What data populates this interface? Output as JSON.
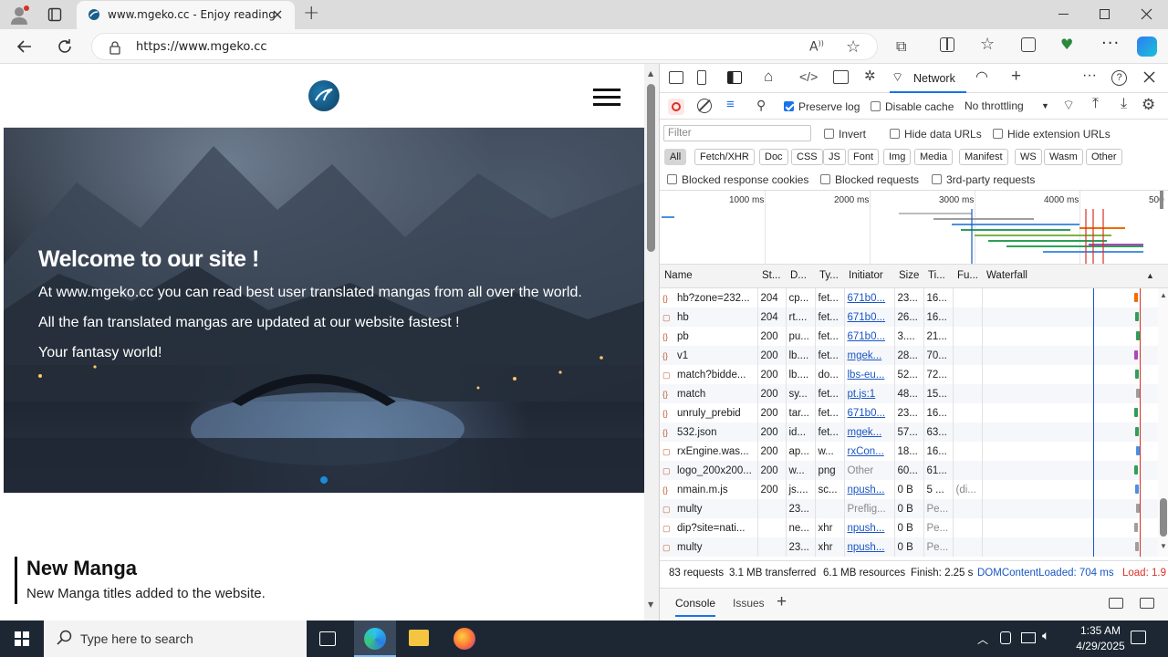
{
  "browser": {
    "tab_title": "www.mgeko.cc - Enjoy reading",
    "url": "https://www.mgeko.cc",
    "new_tab": "+",
    "window_controls": [
      "minimize-icon",
      "maximize-icon",
      "close-icon"
    ]
  },
  "site": {
    "hero_title": "Welcome to our site !",
    "hero_lines": [
      "At www.mgeko.cc you can read best user translated mangas from all over the world.",
      "All the fan translated mangas are updated at our website fastest !",
      "Your fantasy world!"
    ],
    "section_title": "New Manga",
    "section_sub": "New Manga titles added to the website."
  },
  "devtools": {
    "active_tab": "Network",
    "preserve_log": "Preserve log",
    "disable_cache": "Disable cache",
    "throttling": "No throttling",
    "filter_placeholder": "Filter",
    "invert": "Invert",
    "hide_data_urls": "Hide data URLs",
    "hide_extension_urls": "Hide extension URLs",
    "type_filters": [
      "All",
      "Fetch/XHR",
      "Doc",
      "CSS",
      "JS",
      "Font",
      "Img",
      "Media",
      "Manifest",
      "WS",
      "Wasm",
      "Other"
    ],
    "blocked_response_cookies": "Blocked response cookies",
    "blocked_requests": "Blocked requests",
    "third_party": "3rd-party requests",
    "timeline_ticks": [
      "1000 ms",
      "2000 ms",
      "3000 ms",
      "4000 ms",
      "500"
    ],
    "columns": [
      "Name",
      "St...",
      "D...",
      "Ty...",
      "Initiator",
      "Size",
      "Ti...",
      "Fu...",
      "Waterfall"
    ],
    "rows": [
      {
        "name": "hb?zone=232...",
        "status": "204",
        "domain": "cp...",
        "type": "fet...",
        "initiator": "671b0...",
        "size": "23...",
        "time": "16...",
        "fu": "",
        "link": true
      },
      {
        "name": "hb",
        "status": "204",
        "domain": "rt....",
        "type": "fet...",
        "initiator": "671b0...",
        "size": "26...",
        "time": "16...",
        "fu": "",
        "link": true
      },
      {
        "name": "pb",
        "status": "200",
        "domain": "pu...",
        "type": "fet...",
        "initiator": "671b0...",
        "size": "3....",
        "time": "21...",
        "fu": "",
        "link": true
      },
      {
        "name": "v1",
        "status": "200",
        "domain": "lb....",
        "type": "fet...",
        "initiator": "mgek...",
        "size": "28...",
        "time": "70...",
        "fu": "",
        "link": true
      },
      {
        "name": "match?bidde...",
        "status": "200",
        "domain": "lb....",
        "type": "do...",
        "initiator": "lbs-eu...",
        "size": "52...",
        "time": "72...",
        "fu": "",
        "link": true
      },
      {
        "name": "match",
        "status": "200",
        "domain": "sy...",
        "type": "fet...",
        "initiator": "pt.js:1",
        "size": "48...",
        "time": "15...",
        "fu": "",
        "link": true
      },
      {
        "name": "unruly_prebid",
        "status": "200",
        "domain": "tar...",
        "type": "fet...",
        "initiator": "671b0...",
        "size": "23...",
        "time": "16...",
        "fu": "",
        "link": true
      },
      {
        "name": "532.json",
        "status": "200",
        "domain": "id...",
        "type": "fet...",
        "initiator": "mgek...",
        "size": "57...",
        "time": "63...",
        "fu": "",
        "link": true
      },
      {
        "name": "rxEngine.was...",
        "status": "200",
        "domain": "ap...",
        "type": "w...",
        "initiator": "rxCon...",
        "size": "18...",
        "time": "16...",
        "fu": "",
        "link": true
      },
      {
        "name": "logo_200x200...",
        "status": "200",
        "domain": "w...",
        "type": "png",
        "initiator": "Other",
        "size": "60...",
        "time": "61...",
        "fu": "",
        "link": false
      },
      {
        "name": "nmain.m.js",
        "status": "200",
        "domain": "js....",
        "type": "sc...",
        "initiator": "npush...",
        "size": "0 B",
        "time": "5 ...",
        "fu": "(di...",
        "link": true
      },
      {
        "name": "multy",
        "status": "",
        "domain": "23...",
        "type": "",
        "initiator": "Preflig...",
        "size": "0 B",
        "time": "Pe...",
        "fu": "",
        "link": false
      },
      {
        "name": "dip?site=nati...",
        "status": "",
        "domain": "ne...",
        "type": "xhr",
        "initiator": "npush...",
        "size": "0 B",
        "time": "Pe...",
        "fu": "",
        "link": true
      },
      {
        "name": "multy",
        "status": "",
        "domain": "23...",
        "type": "xhr",
        "initiator": "npush...",
        "size": "0 B",
        "time": "Pe...",
        "fu": "",
        "link": true
      }
    ],
    "summary": {
      "requests": "83 requests",
      "transferred": "3.1 MB transferred",
      "resources": "6.1 MB resources",
      "finish": "Finish: 2.25 s",
      "dcl": "DOMContentLoaded: 704 ms",
      "load": "Load: 1.9"
    },
    "drawer_tabs": [
      "Console",
      "Issues"
    ]
  },
  "taskbar": {
    "search_placeholder": "Type here to search",
    "time": "1:35 AM",
    "date": "4/29/2025"
  },
  "colors": {
    "accent": "#1a73e8",
    "taskbar": "#1c2733",
    "hero_dot": "#1a8cd8",
    "load_red": "#d93025",
    "dcl_blue": "#1a56c5"
  }
}
